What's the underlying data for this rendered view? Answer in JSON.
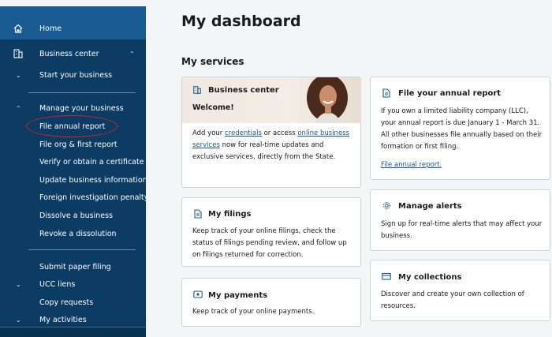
{
  "sidebar": {
    "home": "Home",
    "business_center": "Business center",
    "start_business": "Start your business",
    "manage_business": "Manage your business",
    "file_annual_report": "File annual report",
    "file_org_first_report": "File org & first report",
    "verify_certificate": "Verify or obtain a certificate",
    "update_business_info": "Update business information",
    "foreign_investigation": "Foreign investigation penalty",
    "dissolve_business": "Dissolve a business",
    "revoke_dissolution": "Revoke a dissolution",
    "submit_paper_filing": "Submit paper filing",
    "ucc_liens": "UCC liens",
    "copy_requests": "Copy requests",
    "my_activities": "My activities"
  },
  "main": {
    "title": "My dashboard",
    "section_title": "My services"
  },
  "cards": {
    "business_center": {
      "title": "Business center",
      "welcome": "Welcome!",
      "text_1": "Add your ",
      "link_credentials": "credentials",
      "text_2": " or access ",
      "link_online_services": "online business services",
      "text_3": " now for real-time updates and exclusive services, directly from the State."
    },
    "annual_report": {
      "title": "File your annual report",
      "body": "If you own a limited liability company (LLC), your annual report is due January 1 - March 31. All other businesses file annually based on their formation or first filing.",
      "link": "File annual report."
    },
    "my_filings": {
      "title": "My filings",
      "body": "Keep track of your online filings, check the status of filings pending review, and follow up on filings returned for correction."
    },
    "manage_alerts": {
      "title": "Manage alerts",
      "body": "Sign up for real-time alerts that may affect your business."
    },
    "my_payments": {
      "title": "My payments",
      "body": "Keep track of your online payments."
    },
    "my_collections": {
      "title": "My collections",
      "body": "Discover and create your own collection of resources."
    }
  },
  "colors": {
    "sidebar_bg": "#0c3b63",
    "sidebar_active": "#1a5a92",
    "link": "#1a5a92",
    "annotation": "#d0232a"
  }
}
